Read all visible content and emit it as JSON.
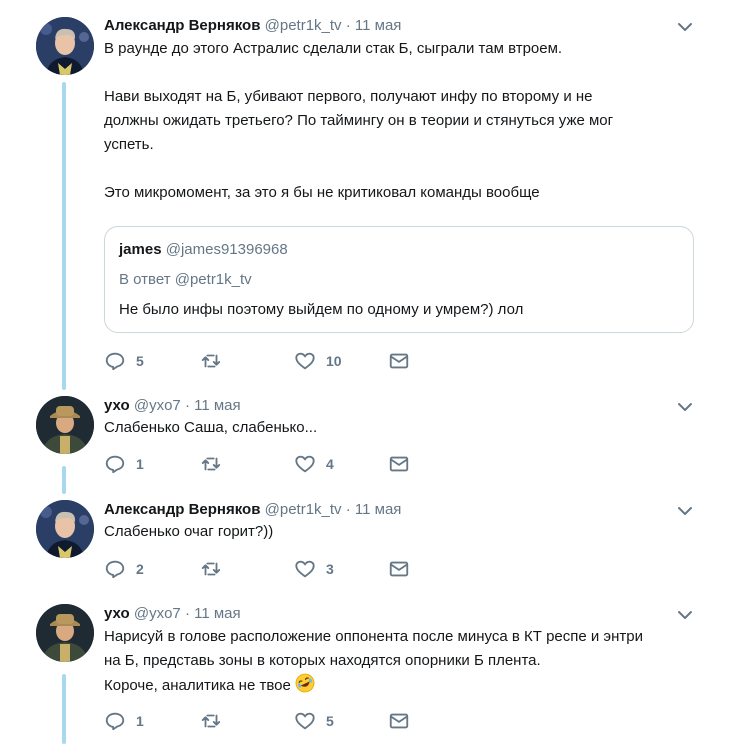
{
  "colors": {
    "accent": "#1da1f2",
    "thread_line": "#a9d7ee",
    "muted": "#657786",
    "text": "#14171a",
    "border": "#ccd6dd"
  },
  "tweets": [
    {
      "author": "Александр Верняков",
      "handle": "@petr1k_tv",
      "dot": "·",
      "date": "11 мая",
      "lines": [
        "В раунде до этого Астралис сделали стак Б, сыграли там втроем.",
        "Нави выходят на Б, убивают первого, получают инфу по второму и не",
        "должны ожидать третьего? По таймингу он в теории и стянуться уже мог",
        "успеть.",
        "Это микромомент, за это я бы не критиковал команды вообще"
      ],
      "quote": {
        "author": "james",
        "handle": "@james91396968",
        "reply_to": "В ответ @petr1k_tv",
        "text": "Не было инфы поэтому выйдем по одному и умрем?) лол"
      },
      "replies": "5",
      "retweets": "",
      "likes": "10"
    },
    {
      "author": "ухо",
      "handle": "@yxo7",
      "dot": "·",
      "date": "11 мая",
      "lines": [
        "Слабенько Саша, слабенько..."
      ],
      "replies": "1",
      "retweets": "",
      "likes": "4"
    },
    {
      "author": "Александр Верняков",
      "handle": "@petr1k_tv",
      "dot": "·",
      "date": "11 мая",
      "lines": [
        "Слабенько очаг горит?))"
      ],
      "replies": "2",
      "retweets": "",
      "likes": "3"
    },
    {
      "author": "ухо",
      "handle": "@yxo7",
      "dot": "·",
      "date": "11 мая",
      "lines": [
        "Нарисуй в голове расположение оппонента после минуса в КТ респе и энтри",
        "на Б, представь зоны в которых находятся опорники Б плента.",
        "Короче, аналитика не твое"
      ],
      "emoji": "rolling-on-floor-laughing",
      "replies": "1",
      "retweets": "",
      "likes": "5"
    }
  ]
}
